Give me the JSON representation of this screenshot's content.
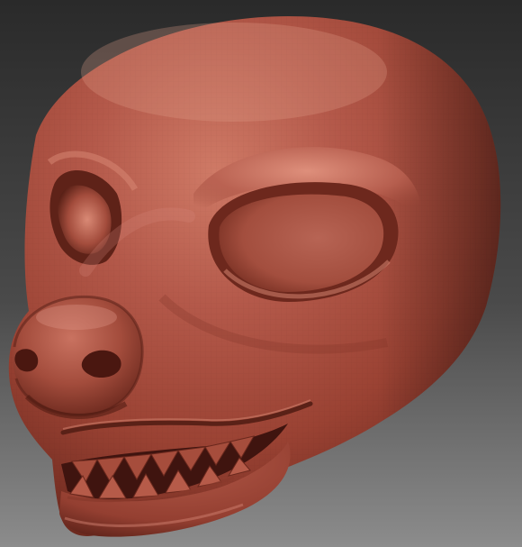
{
  "scene": {
    "subject": "sculpted-creature-head",
    "material": "matte-clay",
    "colors": {
      "background_top": "#2e2e2e",
      "background_bottom": "#8a8a8a",
      "clay_base": "#9e4434",
      "clay_light": "#c8705d",
      "clay_highlight": "#dc8c78",
      "clay_shadow": "#5c2219",
      "clay_deep": "#3f140f",
      "clay_mid": "#b25644"
    }
  }
}
